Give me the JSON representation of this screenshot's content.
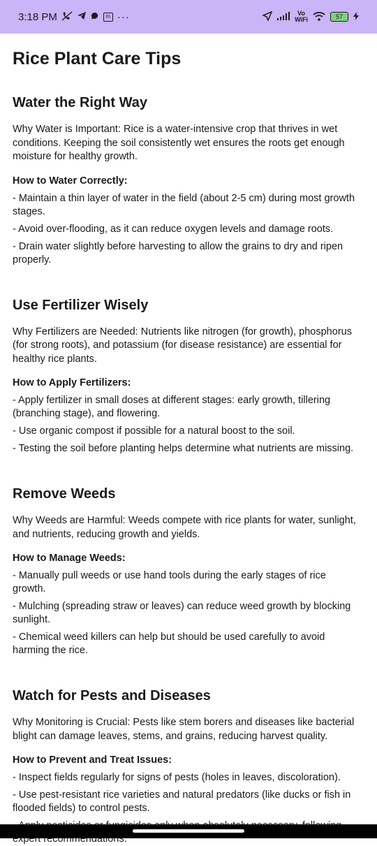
{
  "status": {
    "time": "3:18 PM",
    "battery": "57",
    "vowifi_top": "Vo",
    "vowifi_bottom": "WiFi",
    "dots": "···",
    "m_label": "m"
  },
  "page": {
    "title": "Rice Plant Care Tips"
  },
  "sections": [
    {
      "heading": "Water the Right Way",
      "why": "Why Water is Important: Rice is a water-intensive crop that thrives in wet conditions. Keeping the soil consistently wet ensures the roots get enough moisture for healthy growth.",
      "howto": "How to Water Correctly:",
      "points": [
        "- Maintain a thin layer of water in the field (about 2-5 cm) during most growth stages.",
        "- Avoid over-flooding, as it can reduce oxygen levels and damage roots.",
        "- Drain water slightly before harvesting to allow the grains to dry and ripen properly."
      ]
    },
    {
      "heading": "Use Fertilizer Wisely",
      "why": "Why Fertilizers are Needed: Nutrients like nitrogen (for growth), phosphorus (for strong roots), and potassium (for disease resistance) are essential for healthy rice plants.",
      "howto": "How to Apply Fertilizers:",
      "points": [
        "- Apply fertilizer in small doses at different stages: early growth, tillering (branching stage), and flowering.",
        "- Use organic compost if possible for a natural boost to the soil.",
        "- Testing the soil before planting helps determine what nutrients are missing."
      ]
    },
    {
      "heading": "Remove Weeds",
      "why": "Why Weeds are Harmful: Weeds compete with rice plants for water, sunlight, and nutrients, reducing growth and yields.",
      "howto": "How to Manage Weeds:",
      "points": [
        "- Manually pull weeds or use hand tools during the early stages of rice growth.",
        "- Mulching (spreading straw or leaves) can reduce weed growth by blocking sunlight.",
        "- Chemical weed killers can help but should be used carefully to avoid harming the rice."
      ]
    },
    {
      "heading": "Watch for Pests and Diseases",
      "why": "Why Monitoring is Crucial: Pests like stem borers and diseases like bacterial blight can damage leaves, stems, and grains, reducing harvest quality.",
      "howto": "How to Prevent and Treat Issues:",
      "points": [
        "- Inspect fields regularly for signs of pests (holes in leaves, discoloration).",
        "- Use pest-resistant rice varieties and natural predators (like ducks or fish in flooded fields) to control pests.",
        "- Apply pesticides or fungicides only when absolutely necessary, following expert recommendations."
      ]
    }
  ],
  "colors": {
    "status_bar": "#c9b5f7",
    "text": "#1a1a1a",
    "nav_bar": "#000000"
  },
  "icons": {
    "status_left": [
      "muted-call-icon",
      "telegram-icon",
      "chat-bubble-icon",
      "m-app-icon",
      "more-dots-icon"
    ],
    "status_right": [
      "location-arrow-icon",
      "signal-bars-icon",
      "vowifi-icon",
      "wifi-icon",
      "battery-icon",
      "charging-icon"
    ]
  }
}
